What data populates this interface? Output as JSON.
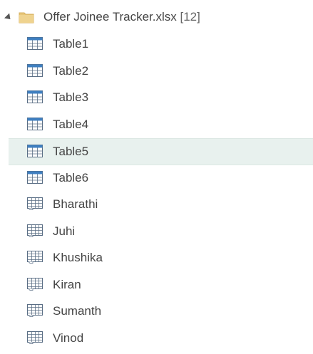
{
  "navigator": {
    "root": {
      "name": "Offer Joinee Tracker.xlsx",
      "count": "[12]",
      "icon": "folder-icon",
      "expanded": true
    },
    "items": [
      {
        "label": "Table1",
        "type": "table",
        "icon": "table-icon"
      },
      {
        "label": "Table2",
        "type": "table",
        "icon": "table-icon"
      },
      {
        "label": "Table3",
        "type": "table",
        "icon": "table-icon"
      },
      {
        "label": "Table4",
        "type": "table",
        "icon": "table-icon"
      },
      {
        "label": "Table5",
        "type": "table",
        "icon": "table-icon",
        "selected": true
      },
      {
        "label": "Table6",
        "type": "table",
        "icon": "table-icon"
      },
      {
        "label": "Bharathi",
        "type": "sheet",
        "icon": "sheet-icon"
      },
      {
        "label": "Juhi",
        "type": "sheet",
        "icon": "sheet-icon"
      },
      {
        "label": "Khushika",
        "type": "sheet",
        "icon": "sheet-icon"
      },
      {
        "label": "Kiran",
        "type": "sheet",
        "icon": "sheet-icon"
      },
      {
        "label": "Sumanth",
        "type": "sheet",
        "icon": "sheet-icon"
      },
      {
        "label": "Vinod",
        "type": "sheet",
        "icon": "sheet-icon"
      }
    ]
  },
  "colors": {
    "folder": "#e8c77a",
    "table_header": "#3f7fc0",
    "selected_bg": "#e8f1ee",
    "text": "#444444"
  }
}
